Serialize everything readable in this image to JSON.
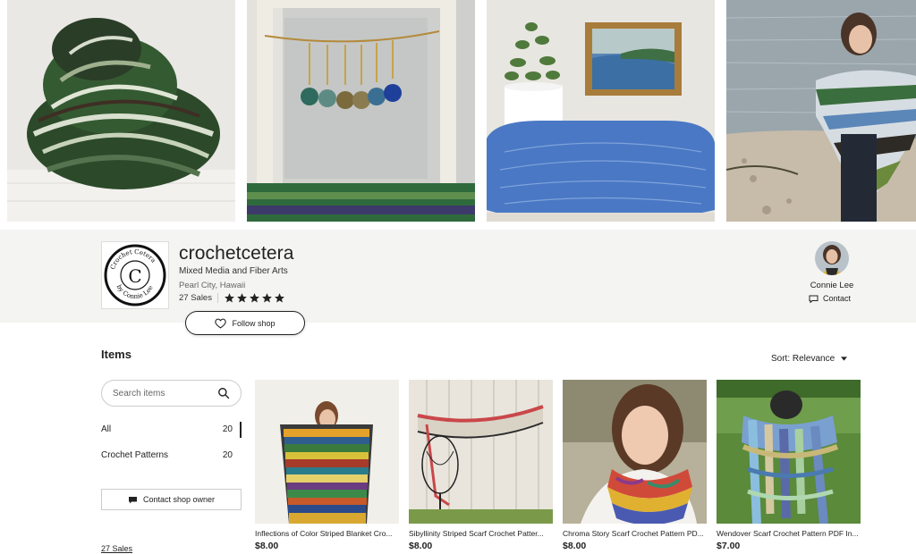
{
  "banner": {
    "images": [
      {
        "icon": "yarn-skein-image"
      },
      {
        "icon": "stitch-markers-frame-image"
      },
      {
        "icon": "doily-plant-image"
      },
      {
        "icon": "woman-shawl-beach-image"
      }
    ]
  },
  "shop": {
    "logo_text": "Crochet Cetera by Connie Lee",
    "name": "crochetcetera",
    "tagline": "Mixed Media and Fiber Arts",
    "location": "Pearl City, Hawaii",
    "sales": "27 Sales",
    "rating": 5,
    "follow_label": "Follow shop"
  },
  "owner": {
    "name": "Connie Lee",
    "contact_label": "Contact"
  },
  "items": {
    "heading": "Items",
    "sort_label": "Sort: Relevance",
    "search_placeholder": "Search items",
    "categories": [
      {
        "label": "All",
        "count": "20"
      },
      {
        "label": "Crochet Patterns",
        "count": "20"
      }
    ],
    "contact_owner_label": "Contact shop owner",
    "bottom_sales": "27 Sales"
  },
  "products": [
    {
      "title": "Inflections of Color Striped Blanket Cro...",
      "price": "$8.00"
    },
    {
      "title": "Sibyllinity Striped Scarf Crochet Patter...",
      "price": "$8.00"
    },
    {
      "title": "Chroma Story Scarf Crochet Pattern PD...",
      "price": "$8.00"
    },
    {
      "title": "Wendover Scarf Crochet Pattern PDF In...",
      "price": "$7.00"
    }
  ],
  "colors": {
    "band_bg": "#f4f4f3",
    "text": "#222222",
    "star": "#222222"
  }
}
